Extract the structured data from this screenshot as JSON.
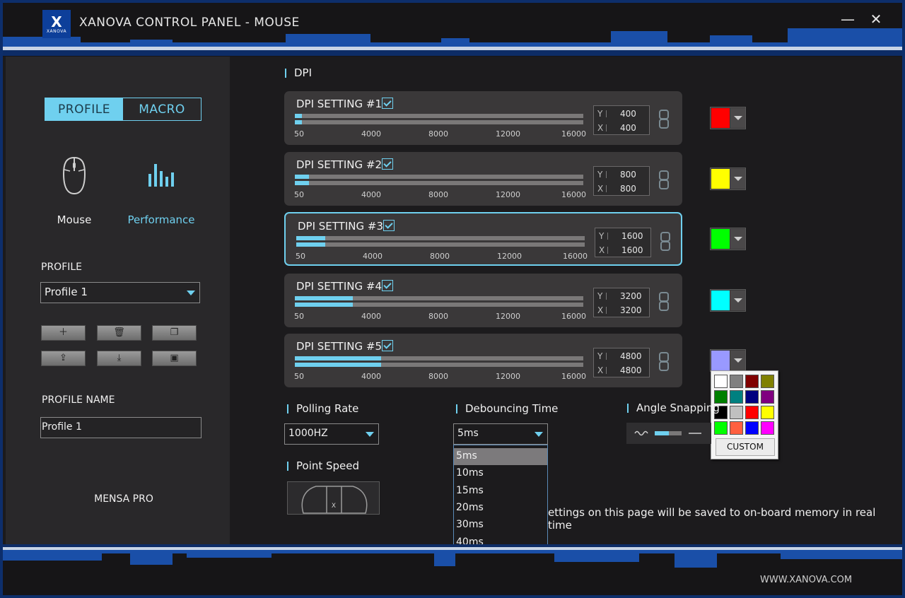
{
  "window": {
    "title": "XANOVA CONTROL PANEL - MOUSE",
    "logo_text": "XANOVA",
    "minimize": "—",
    "close": "✕"
  },
  "left": {
    "tabs": [
      "PROFILE",
      "MACRO"
    ],
    "modes": [
      {
        "label": "Mouse",
        "icon": "mouse-icon"
      },
      {
        "label": "Performance",
        "icon": "performance-icon"
      }
    ],
    "profile_label": "PROFILE",
    "profile_selected": "Profile 1",
    "profile_buttons": [
      "add-icon",
      "delete-icon",
      "copy-icon",
      "export-icon",
      "import-icon",
      "save-icon"
    ],
    "profile_name_label": "PROFILE NAME",
    "profile_name_value": "Profile 1",
    "device_name": "MENSA PRO"
  },
  "main": {
    "dpi_section": "DPI",
    "tick_labels": [
      "50",
      "4000",
      "8000",
      "12000",
      "16000"
    ],
    "dpi_max": 16000,
    "dpi_settings": [
      {
        "name": "DPI SETTING #1",
        "y": "400",
        "x": "400",
        "checked": true,
        "color": "#ff0000",
        "selected": false
      },
      {
        "name": "DPI SETTING #2",
        "y": "800",
        "x": "800",
        "checked": true,
        "color": "#ffff00",
        "selected": false
      },
      {
        "name": "DPI SETTING #3",
        "y": "1600",
        "x": "1600",
        "checked": true,
        "color": "#00ff00",
        "selected": true
      },
      {
        "name": "DPI SETTING #4",
        "y": "3200",
        "x": "3200",
        "checked": true,
        "color": "#00ffff",
        "selected": false
      },
      {
        "name": "DPI SETTING #5",
        "y": "4800",
        "x": "4800",
        "checked": true,
        "color": "#9999ff",
        "selected": false
      }
    ],
    "axis_y": "Y",
    "axis_x": "X",
    "palette_colors": [
      "#ffffff",
      "#808080",
      "#800000",
      "#808000",
      "#008000",
      "#008080",
      "#000080",
      "#800080",
      "#000000",
      "#c0c0c0",
      "#ff0000",
      "#ffff00",
      "#00ff00",
      "#ff6040",
      "#0000ff",
      "#ff00ff"
    ],
    "palette_custom": "CUSTOM",
    "polling_rate_label": "Polling Rate",
    "polling_rate_value": "1000HZ",
    "debouncing_label": "Debouncing Time",
    "debouncing_value": "5ms",
    "debouncing_options": [
      "5ms",
      "10ms",
      "15ms",
      "20ms",
      "30ms",
      "40ms"
    ],
    "angle_label": "Angle Snapping",
    "point_speed_label": "Point Speed",
    "note": "ettings on this page will be saved to on-board memory in real time",
    "website": "WWW.XANOVA.COM"
  },
  "accent": "#6fd0ef"
}
